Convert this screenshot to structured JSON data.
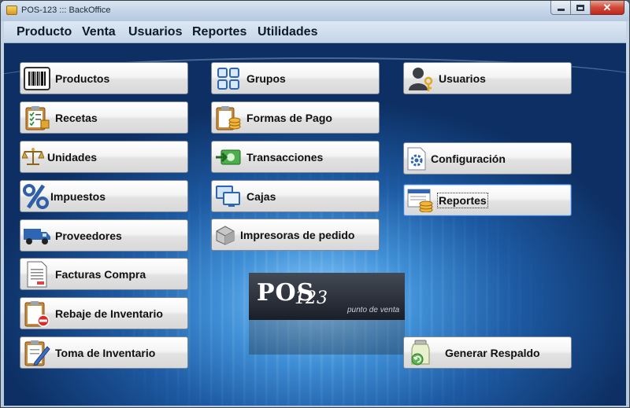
{
  "window": {
    "title": "POS-123 ::: BackOffice"
  },
  "menu": [
    {
      "label": "Producto"
    },
    {
      "label": "Venta"
    },
    {
      "label": "Usuarios"
    },
    {
      "label": "Reportes"
    },
    {
      "label": "Utilidades"
    }
  ],
  "buttons": {
    "productos": "Productos",
    "recetas": "Recetas",
    "unidades": "Unidades",
    "impuestos": "Impuestos",
    "proveedores": "Proveedores",
    "facturas": "Facturas Compra",
    "rebaje": "Rebaje de Inventario",
    "toma": "Toma de Inventario",
    "grupos": "Grupos",
    "formas_pago": "Formas de Pago",
    "transacciones": "Transacciones",
    "cajas": "Cajas",
    "impresoras": "Impresoras de pedido",
    "usuarios": "Usuarios",
    "configuracion": "Configuración",
    "reportes": "Reportes",
    "respaldo": "Generar Respaldo"
  },
  "logo": {
    "brand": "POS",
    "number": "123",
    "tagline": "punto de venta"
  },
  "icons": {
    "productos": "barcode-icon",
    "recetas": "clipboard-checklist-icon",
    "unidades": "scale-icon",
    "impuestos": "percent-icon",
    "proveedores": "truck-icon",
    "facturas": "invoice-icon",
    "rebaje": "clipboard-remove-icon",
    "toma": "clipboard-pencil-icon",
    "grupos": "grid-icon",
    "formas_pago": "clipboard-coins-icon",
    "transacciones": "money-arrow-icon",
    "cajas": "monitors-icon",
    "impresoras": "printer-box-icon",
    "usuarios": "user-key-icon",
    "configuracion": "gear-document-icon",
    "reportes": "report-coins-icon",
    "respaldo": "backup-jar-icon"
  },
  "colors": {
    "accent": "#3d7bd0",
    "close_button": "#c0281c"
  }
}
